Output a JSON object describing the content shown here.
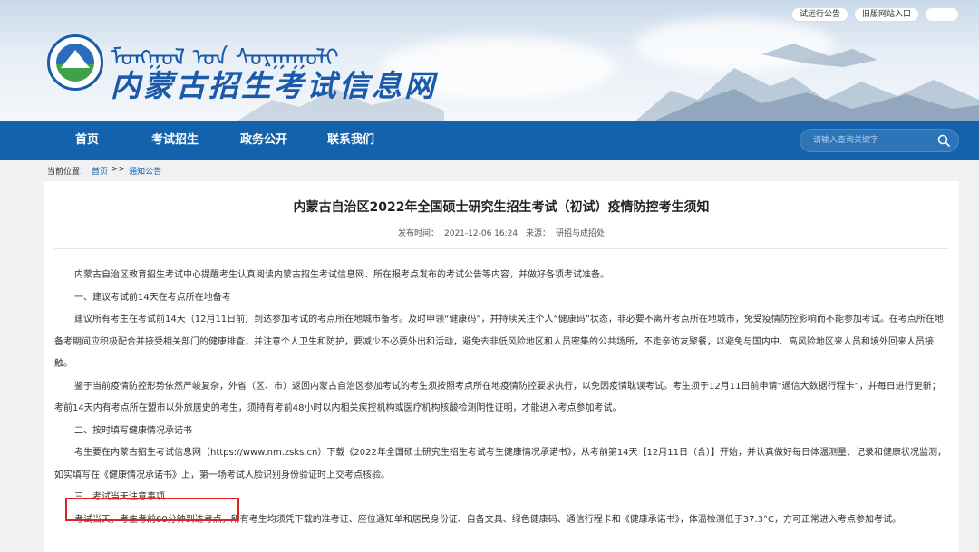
{
  "header": {
    "mongolian_title": "ᠮᠣᠩᠭᠣᠯ ᠤᠨ ᠰᠤᠷᠭᠠᠭᠤᠯᠢ",
    "site_title": "内蒙古招生考试信息网",
    "top_links": [
      "试运行公告",
      "旧版网站入口"
    ],
    "logo_icon": "logo-emblem"
  },
  "nav": {
    "items": [
      "首页",
      "考试招生",
      "政务公开",
      "联系我们"
    ],
    "search_placeholder": "请输入查询关键字",
    "search_icon": "search-icon"
  },
  "breadcrumb": {
    "label": "当前位置：",
    "home": "首页",
    "sep": ">>",
    "section": "通知公告"
  },
  "article": {
    "title": "内蒙古自治区2022年全国硕士研究生招生考试（初试）疫情防控考生须知",
    "publish_label": "发布时间：",
    "publish_time": "2021-12-06 16:24",
    "source_label": "来源：",
    "source": "研招与成招处",
    "paragraphs": [
      "内蒙古自治区教育招生考试中心提醒考生认真阅读内蒙古招生考试信息网、所在报考点发布的考试公告等内容，并做好各项考试准备。",
      "一、建议考试前14天在考点所在地备考",
      "建议所有考生在考试前14天（12月11日前）到达参加考试的考点所在地城市备考。及时申领“健康码”，并持续关注个人“健康码”状态，非必要不离开考点所在地城市，免受疫情防控影响而不能参加考试。在考点所在地备考期间应积极配合并接受相关部门的健康排查，并注意个人卫生和防护，要减少不必要外出和活动，避免去非低风险地区和人员密集的公共场所，不走亲访友聚餐，以避免与国内中、高风险地区来人员和境外回来人员接触。",
      "鉴于当前疫情防控形势依然严峻复杂，外省（区、市）返回内蒙古自治区参加考试的考生须按照考点所在地疫情防控要求执行，以免因疫情耽误考试。考生须于12月11日前申请“通信大数据行程卡”，并每日进行更新；考前14天内有考点所在盟市以外旅居史的考生，须持有考前48小时以内相关疾控机构或医疗机构核酸检测阴性证明，才能进入考点参加考试。",
      "二、按时填写健康情况承诺书",
      "考生要在内蒙古招生考试信息网（https://www.nm.zsks.cn）下载《2022年全国硕士研究生招生考试考生健康情况承诺书》，从考前第14天【12月11日（含）】开始，并认真做好每日体温测量、记录和健康状况监测，如实填写在《健康情况承诺书》上，第一场考试人脸识别身份验证时上交考点核验。",
      "三、考试当天注意事项",
      "考试当天，考生考前60分钟到达考点，所有考生均须凭下载的准考证、座位通知单和居民身份证、自备文具、绿色健康码、通信行程卡和《健康承诺书》，体温检测低于37.3°C，方可正常进入考点参加考试。"
    ]
  },
  "colors": {
    "nav_bg": "#1462ab",
    "title_blue": "#1a5aa8",
    "highlight_red": "#e02222"
  }
}
